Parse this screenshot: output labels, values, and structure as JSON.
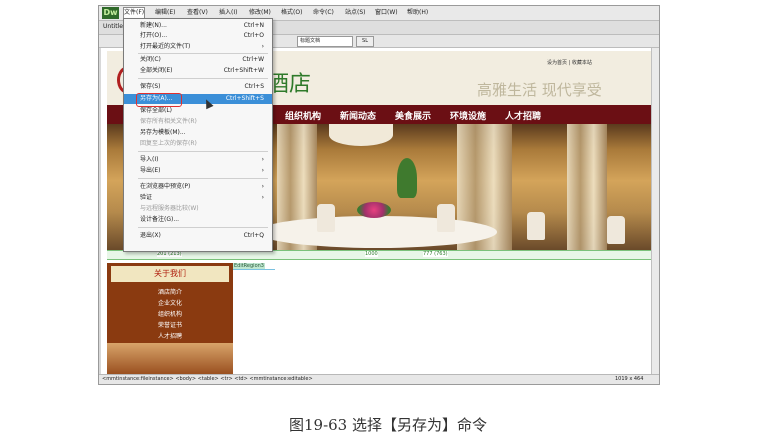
{
  "app": {
    "logo": "Dw",
    "tab_title": "Untitle"
  },
  "menubar": [
    "文件(F)",
    "编辑(E)",
    "查看(V)",
    "插入(I)",
    "修改(M)",
    "格式(O)",
    "命令(C)",
    "站点(S)",
    "窗口(W)",
    "帮助(H)"
  ],
  "toolbar": {
    "title_field": "标题文档",
    "button": "SL"
  },
  "file_menu": [
    {
      "label": "新建(N)...",
      "shortcut": "Ctrl+N"
    },
    {
      "label": "打开(O)...",
      "shortcut": "Ctrl+O"
    },
    {
      "label": "打开最近的文件(T)",
      "shortcut": "",
      "submenu": true
    },
    {
      "label": "关闭(C)",
      "shortcut": "Ctrl+W"
    },
    {
      "label": "全部关闭(E)",
      "shortcut": "Ctrl+Shift+W"
    },
    {
      "label": "保存(S)",
      "shortcut": "Ctrl+S"
    },
    {
      "label": "另存为(A)...",
      "shortcut": "Ctrl+Shift+S",
      "highlighted": true
    },
    {
      "label": "保存全部(L)",
      "shortcut": ""
    },
    {
      "label": "保存所有相关文件(R)",
      "shortcut": "",
      "disabled": true
    },
    {
      "label": "另存为模板(M)...",
      "shortcut": ""
    },
    {
      "label": "回复至上次的保存(R)",
      "shortcut": "",
      "disabled": true
    },
    {
      "label": "导入(I)",
      "shortcut": "",
      "submenu": true
    },
    {
      "label": "导出(E)",
      "shortcut": "",
      "submenu": true
    },
    {
      "label": "在浏览器中预览(P)",
      "shortcut": "",
      "submenu": true
    },
    {
      "label": "验证",
      "shortcut": "",
      "submenu": true
    },
    {
      "label": "与远程服务器比较(W)",
      "shortcut": "",
      "disabled": true
    },
    {
      "label": "设计备注(G)...",
      "shortcut": ""
    },
    {
      "label": "退出(X)",
      "shortcut": "Ctrl+Q"
    }
  ],
  "site": {
    "title": "酒店",
    "slogan": "高雅生活 现代享受",
    "top_links": "设为首页 | 收藏本站",
    "nav": [
      "组织机构",
      "新闻动态",
      "美食展示",
      "环境设施",
      "人才招聘"
    ],
    "ruler_left": "201 (213)",
    "ruler_mid": "1000",
    "ruler_right": "777 (763)",
    "sidebar_title": "关于我们",
    "sidebar_items": [
      "酒店简介",
      "企业文化",
      "组织机构",
      "荣誉证书",
      "人才招聘"
    ],
    "editable_tag": "EditRegion3"
  },
  "statusbar": {
    "path": "<mmtinstance:fileinstance> <body> <table> <tr> <td> <mmtinstance:editable>",
    "right": "1019 x 464"
  },
  "caption": "图19-63  选择【另存为】命令"
}
